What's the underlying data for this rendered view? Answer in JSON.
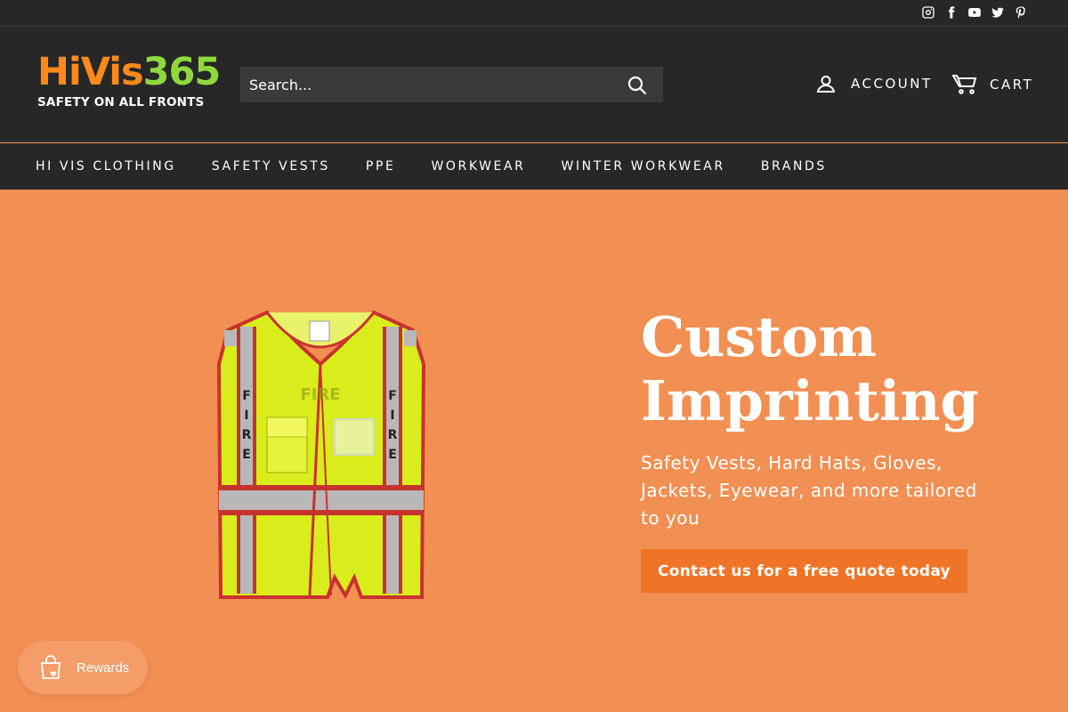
{
  "topbar": {
    "social_icons": [
      "instagram-icon",
      "facebook-icon",
      "youtube-icon",
      "twitter-icon",
      "pinterest-icon"
    ]
  },
  "header": {
    "logo": {
      "brand_part1": "HiVis",
      "brand_part2": "365",
      "tagline": "SAFETY ON ALL FRONTS"
    },
    "search": {
      "placeholder": "Search..."
    },
    "account_label": "ACCOUNT",
    "cart_label": "CART"
  },
  "nav": {
    "items": [
      "HI VIS CLOTHING",
      "SAFETY VESTS",
      "PPE",
      "WORKWEAR",
      "WINTER WORKWEAR",
      "BRANDS"
    ]
  },
  "hero": {
    "title": "Custom Imprinting",
    "subtitle": "Safety Vests, Hard Hats, Gloves, Jackets, Eyewear, and more tailored to you",
    "cta_label": "Contact us for a free quote today",
    "vest_text_left": "FIRE",
    "vest_text_right": "FIRE",
    "vest_text_back": "FIRE"
  },
  "rewards": {
    "label": "Rewards"
  },
  "colors": {
    "header_bg": "#272727",
    "hero_bg": "#f28f52",
    "cta_bg": "#f07427",
    "vest_yellow": "#d9ec1c",
    "vest_red_trim": "#c8322e",
    "reflective_grey": "#b8b8b8"
  }
}
